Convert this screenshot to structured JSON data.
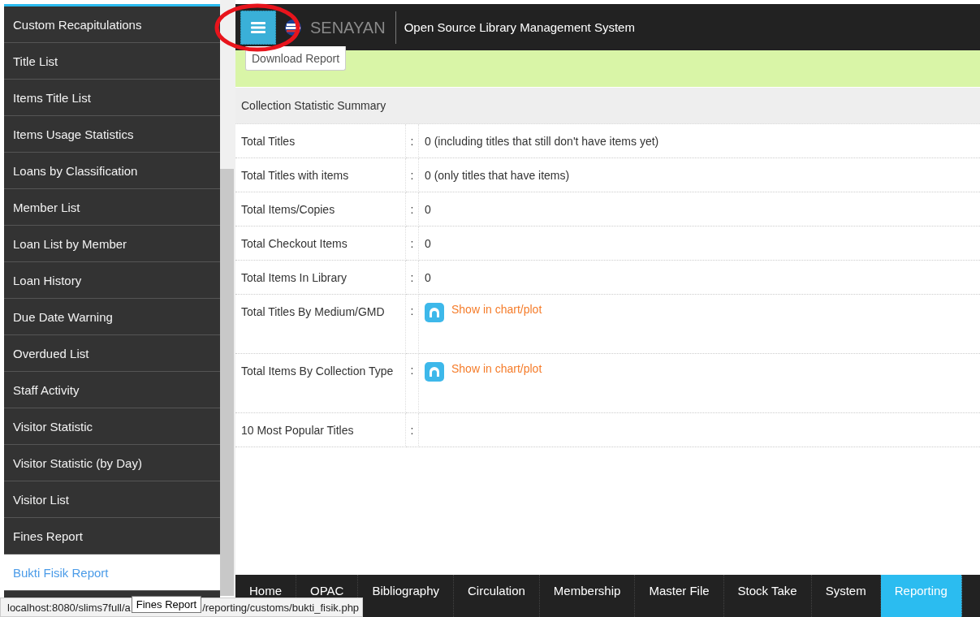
{
  "sidebar": {
    "items": [
      {
        "label": "Custom Recapitulations",
        "selected": false
      },
      {
        "label": "Title List",
        "selected": false
      },
      {
        "label": "Items Title List",
        "selected": false
      },
      {
        "label": "Items Usage Statistics",
        "selected": false
      },
      {
        "label": "Loans by Classification",
        "selected": false
      },
      {
        "label": "Member List",
        "selected": false
      },
      {
        "label": "Loan List by Member",
        "selected": false
      },
      {
        "label": "Loan History",
        "selected": false
      },
      {
        "label": "Due Date Warning",
        "selected": false
      },
      {
        "label": "Overdued List",
        "selected": false
      },
      {
        "label": "Staff Activity",
        "selected": false
      },
      {
        "label": "Visitor Statistic",
        "selected": false
      },
      {
        "label": "Visitor Statistic (by Day)",
        "selected": false
      },
      {
        "label": "Visitor List",
        "selected": false
      },
      {
        "label": "Fines Report",
        "selected": false
      },
      {
        "label": "Bukti Fisik Report",
        "selected": true
      }
    ]
  },
  "header": {
    "brand": "SENAYAN",
    "subtitle": "Open Source Library Management System"
  },
  "toolbar": {
    "button": "Download Report"
  },
  "summary": {
    "title": "Collection Statistic Summary",
    "rows": [
      {
        "label": "Total Titles",
        "separator": ":",
        "kind": "text",
        "value": "0 (including titles that still don't have items yet)"
      },
      {
        "label": "Total Titles with items",
        "separator": ":",
        "kind": "text",
        "value": "0 (only titles that have items)"
      },
      {
        "label": "Total Items/Copies",
        "separator": ":",
        "kind": "text",
        "value": "0"
      },
      {
        "label": "Total Checkout Items",
        "separator": ":",
        "kind": "text",
        "value": "0"
      },
      {
        "label": "Total Items In Library",
        "separator": ":",
        "kind": "text",
        "value": "0"
      },
      {
        "label": "Total Titles By Medium/GMD",
        "separator": ":",
        "kind": "link",
        "value": "Show in chart/plot"
      },
      {
        "label": "Total Items By Collection Type",
        "separator": ":",
        "kind": "link",
        "value": "Show in chart/plot"
      },
      {
        "label": "10 Most Popular Titles",
        "separator": ":",
        "kind": "empty"
      }
    ]
  },
  "nav_tabs": [
    {
      "label": "Home",
      "selected": false
    },
    {
      "label": "OPAC",
      "selected": false
    },
    {
      "label": "Bibliography",
      "selected": false
    },
    {
      "label": "Circulation",
      "selected": false
    },
    {
      "label": "Membership",
      "selected": false
    },
    {
      "label": "Master File",
      "selected": false
    },
    {
      "label": "Stock Take",
      "selected": false
    },
    {
      "label": "System",
      "selected": false
    },
    {
      "label": "Reporting",
      "selected": true
    }
  ],
  "status_bar": {
    "url_start": "localhost:8080/slims7full/a",
    "url_end": "/reporting/customs/bukti_fisik.php",
    "tooltip": "Fines Report"
  }
}
